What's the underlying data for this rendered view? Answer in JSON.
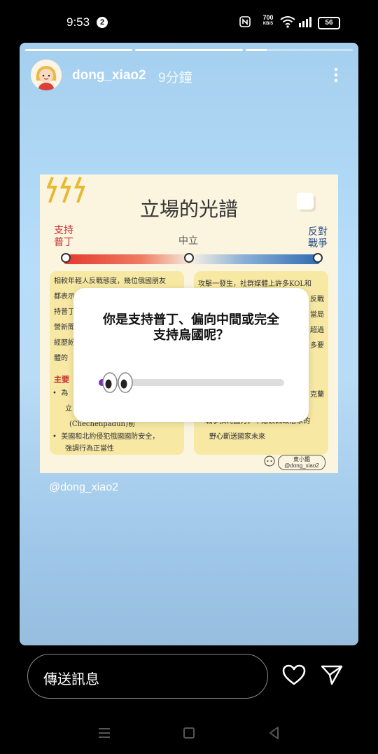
{
  "status_bar": {
    "time": "9:53",
    "notification_count": "2",
    "speed_value": "700",
    "speed_unit": "KB/S",
    "battery": "56",
    "icons": [
      "nfc-icon",
      "wifi-icon",
      "signal-icon",
      "battery-icon"
    ]
  },
  "story": {
    "progress": [
      1,
      1,
      0.2
    ],
    "username": "dong_xiao2",
    "time_ago": "9分鐘",
    "mention": "@dong_xiao2",
    "colors": {
      "background_top": "#a5cfee",
      "background_bottom": "#97bedf"
    }
  },
  "post": {
    "title": "立場的光譜",
    "label_left": "支持\n普丁",
    "label_mid": "中立",
    "label_right": "反對\n戰爭",
    "left_card_lines": [
      "相較年輕人反戰態度，幾位俄國朋友",
      "都表示",
      "持普丁",
      "營新聞",
      "經歷紛",
      "體的"
    ],
    "left_card_heading": "主要",
    "left_bullets": [
      "為",
      "立",
      "(Chechenpadun)前",
      "美國和北約侵犯俄國國防安全，",
      "強調行為正當性"
    ],
    "right_card_lines": [
      "攻擊一發生，社群媒體上許多KOL和",
      "反戰",
      "當局",
      "超過",
      "多要"
    ],
    "right_bullets": [
      "克蘭",
      "戰爭損耗國力，不應該因政治家的",
      "野心斷送國家未來"
    ],
    "signature_name": "東小餓",
    "signature_handle": "@dong_xiao2"
  },
  "poll": {
    "question": "你是支持普丁、偏向中間或完全支持烏國呢？",
    "slider_value": 0.04,
    "slider_color": "#7b2fbf",
    "emoji": "eyes"
  },
  "bottom_bar": {
    "message_placeholder": "傳送訊息",
    "icons": [
      "heart-icon",
      "send-icon"
    ]
  },
  "nav_bar": {
    "icons": [
      "menu-icon",
      "home-icon",
      "back-icon"
    ]
  }
}
